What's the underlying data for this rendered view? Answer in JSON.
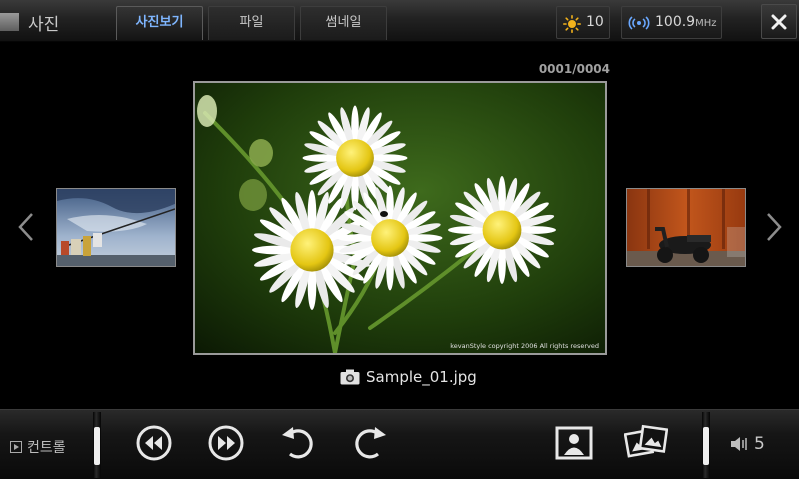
{
  "app": {
    "title": "사진"
  },
  "tabs": [
    {
      "label": "사진보기",
      "active": true
    },
    {
      "label": "파일",
      "active": false
    },
    {
      "label": "썸네일",
      "active": false
    }
  ],
  "status": {
    "brightness": {
      "icon": "sun-icon",
      "value": "10"
    },
    "radio": {
      "icon": "broadcast-icon",
      "frequency": "100.9",
      "unit": "MHz"
    }
  },
  "viewer": {
    "counter": "0001/0004",
    "current_file": "Sample_01.jpg",
    "main_image_watermark": "kevanStyle  copyright 2006 All rights reserved"
  },
  "controls": {
    "label": "컨트롤",
    "buttons": [
      {
        "name": "previous-button",
        "icon": "rewind-icon"
      },
      {
        "name": "next-button",
        "icon": "fast-forward-icon"
      },
      {
        "name": "rotate-left-button",
        "icon": "rotate-left-icon"
      },
      {
        "name": "rotate-right-button",
        "icon": "rotate-right-icon"
      },
      {
        "name": "set-wallpaper-button",
        "icon": "portrait-icon"
      },
      {
        "name": "slideshow-button",
        "icon": "photos-icon"
      }
    ],
    "volume": "5"
  },
  "colors": {
    "active_tab_text": "#7fb6ff",
    "background": "#000000",
    "radio_icon": "#6aa8ff",
    "brightness_icon": "#f2b21c"
  }
}
